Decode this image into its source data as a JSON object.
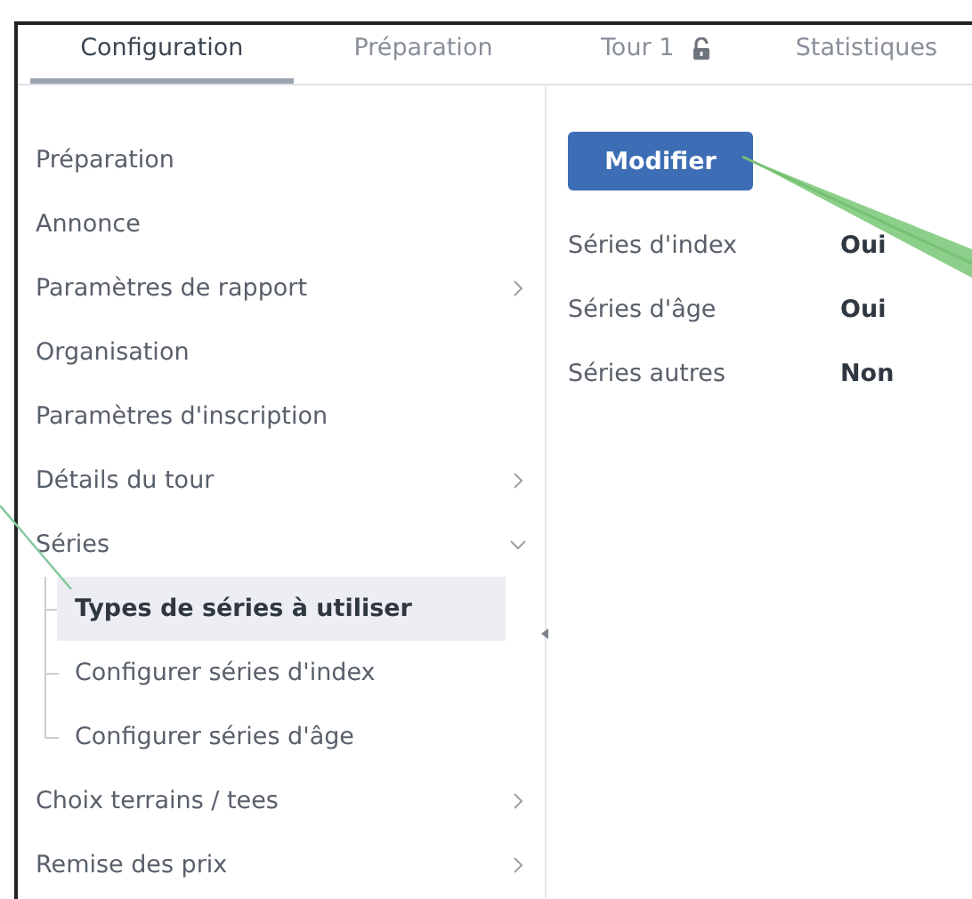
{
  "tabs": [
    {
      "label": "Configuration",
      "selected": true,
      "locked": false
    },
    {
      "label": "Préparation",
      "selected": false,
      "locked": false
    },
    {
      "label": "Tour 1",
      "selected": false,
      "locked": true
    },
    {
      "label": "Statistiques",
      "selected": false,
      "locked": false
    }
  ],
  "sidebar": {
    "items": [
      {
        "label": "Préparation",
        "selected": false
      },
      {
        "label": "Annonce",
        "selected": false
      },
      {
        "label": "Paramètres de rapport",
        "selected": false,
        "expanded": false
      },
      {
        "label": "Organisation",
        "selected": false
      },
      {
        "label": "Paramètres d'inscription",
        "selected": false
      },
      {
        "label": "Détails du tour",
        "selected": false,
        "expanded": false
      },
      {
        "label": "Séries",
        "selected": false,
        "expanded": true,
        "children": [
          {
            "label": "Types de séries à utiliser",
            "selected": true
          },
          {
            "label": "Configurer séries d'index",
            "selected": false
          },
          {
            "label": "Configurer séries d'âge",
            "selected": false
          }
        ]
      },
      {
        "label": "Choix terrains / tees",
        "selected": false,
        "expanded": false
      },
      {
        "label": "Remise des prix",
        "selected": false,
        "expanded": false
      }
    ]
  },
  "panel": {
    "button": "Modifier",
    "fields": [
      {
        "label": "Séries d'index",
        "value": "Oui"
      },
      {
        "label": "Séries d'âge",
        "value": "Oui"
      },
      {
        "label": "Séries autres",
        "value": "Non"
      }
    ]
  }
}
